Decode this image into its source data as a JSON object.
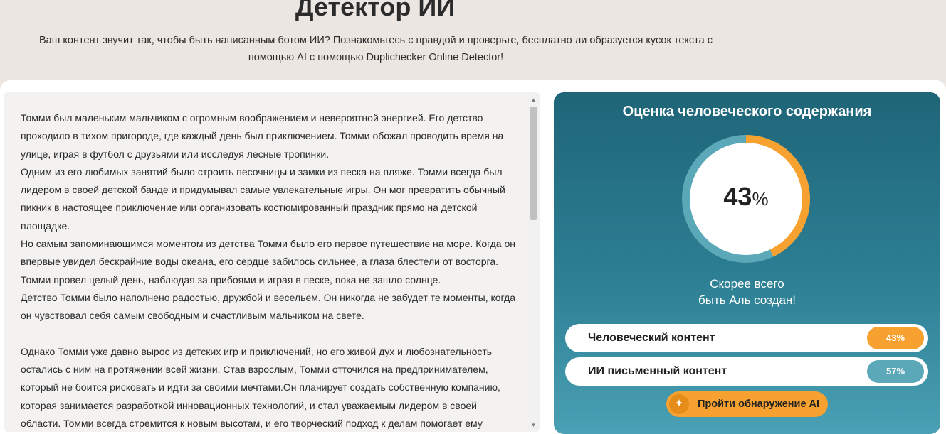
{
  "header": {
    "title": "Детектор ИИ",
    "description": "Ваш контент звучит так, чтобы быть написанным ботом ИИ? Познакомьтесь с правдой и проверьте, бесплатно ли образуется кусок текста с помощью AI с помощью Duplichecker Online Detector!"
  },
  "editor": {
    "paragraphs": [
      "Томми был маленьким мальчиком с огромным воображением и невероятной энергией. Его детство проходило в тихом пригороде, где каждый день был приключением. Томми обожал проводить время на улице, играя в футбол с друзьями или исследуя лесные тропинки.",
      "Одним из его любимых занятий было строить песочницы и замки из песка на пляже. Томми всегда был лидером в своей детской банде и придумывал самые увлекательные игры. Он мог превратить обычный пикник в настоящее приключение или организовать костюмированный праздник прямо на детской площадке.",
      "Но самым запоминающимся моментом из детства Томми было его первое путешествие на море. Когда он впервые увидел бескрайние воды океана, его сердце забилось сильнее, а глаза блестели от восторга. Томми провел целый день, наблюдая за прибоями и играя в песке, пока не зашло солнце.",
      "Детство Томми было наполнено радостью, дружбой и весельем. Он никогда не забудет те моменты, когда он чувствовал себя самым свободным и счастливым мальчиком на свете.",
      "Однако Томми уже давно вырос из детских игр и приключений, но его живой дух и любознательность остались с ним на протяжении всей жизни. Став взрослым, Томми отточился на предпринимателем, который не боится рисковать и идти за своими мечтами.Он планирует создать собственную компанию, которая занимается разработкой инновационных технологий, и стал уважаемым лидером в своей области. Томми всегда стремится к новым высотам, и его творческий подход к делам помогает ему"
    ]
  },
  "result": {
    "title": "Оценка человеческого содержания",
    "score": "43",
    "score_unit": "%",
    "human_fraction": 0.43,
    "verdict_line1": "Скорее всего",
    "verdict_line2": "быть Аль создан!",
    "metrics": [
      {
        "label": "Человеческий контент",
        "value": "43%",
        "color": "#f7a130"
      },
      {
        "label": "ИИ письменный контент",
        "value": "57%",
        "color": "#5aa8b8"
      }
    ],
    "cta_label": "Пройти обнаружение AI",
    "colors": {
      "human": "#f7a130",
      "ai": "#5aa8b8",
      "panel_top": "#1f6578",
      "panel_bottom": "#4aa0b4"
    }
  }
}
